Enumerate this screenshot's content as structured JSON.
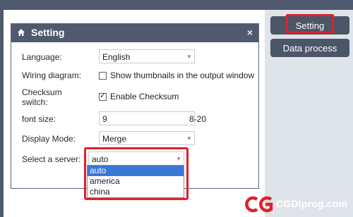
{
  "side": {
    "setting_label": "Setting",
    "data_process_label": "Data process"
  },
  "dialog": {
    "title": "Setting",
    "close_glyph": "×",
    "language": {
      "label": "Language:",
      "value": "English"
    },
    "wiring": {
      "label": "Wiring diagram:",
      "checkbox_label": "Show thumbnails in the output window",
      "checked": false
    },
    "checksum": {
      "label_line1": "Checksum",
      "label_line2": "switch:",
      "checkbox_label": "Enable Checksum",
      "checked": true,
      "check_glyph": "✓"
    },
    "font_size": {
      "label": "font size:",
      "value": "9",
      "range": "8-20"
    },
    "display_mode": {
      "label": "Display Mode:",
      "value": "Merge"
    },
    "server": {
      "label": "Select a server:",
      "value": "auto",
      "options": [
        "auto",
        "america",
        "china"
      ],
      "selected_index": 0
    }
  },
  "logo": {
    "text": "CGDIprog.com",
    "accent": "#e0202a"
  },
  "colors": {
    "highlight": "#e0202a",
    "title_bar": "#4f5a6e",
    "selected_option": "#3a78d8"
  },
  "icons": {
    "title": "home-icon",
    "combo_arrow": "chevron-down-icon"
  }
}
